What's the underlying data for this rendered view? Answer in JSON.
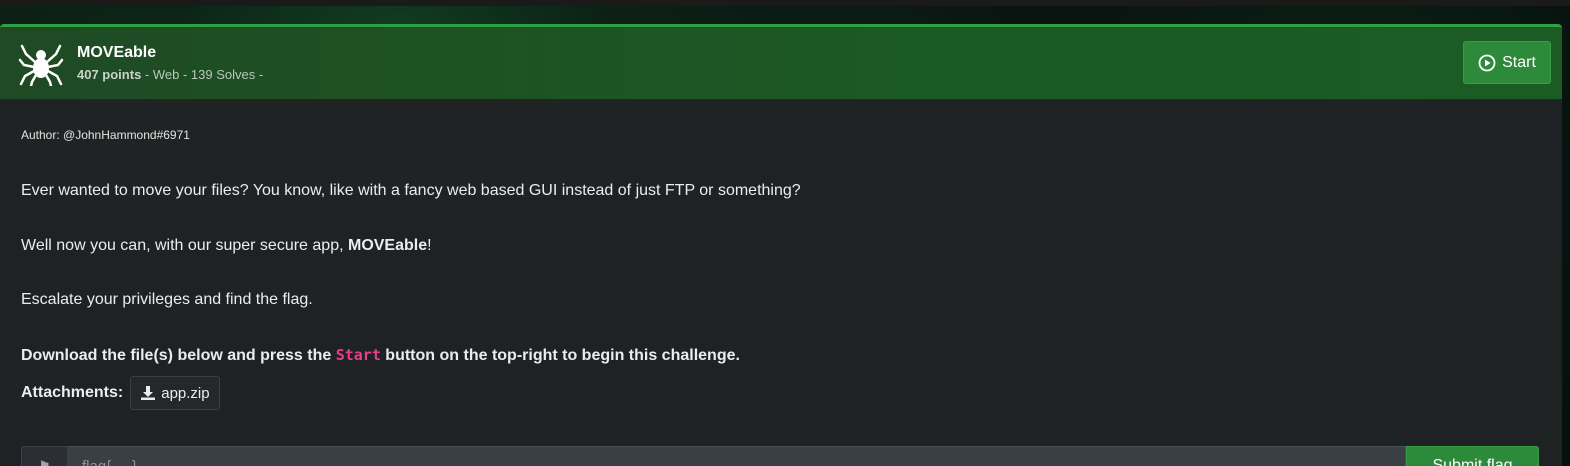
{
  "challenge": {
    "title": "MOVEable",
    "points": "407 points",
    "meta_rest": " - Web - 139 Solves -",
    "icon": "spider-icon",
    "start_label": "Start"
  },
  "body": {
    "author": "Author: @JohnHammond#6971",
    "para1": "Ever wanted to move your files? You know, like with a fancy web based GUI instead of just FTP or something?",
    "para2_pre": "Well now you can, with our super secure app, ",
    "para2_bold": "MOVEable",
    "para2_post": "!",
    "para3": "Escalate your privileges and find the flag.",
    "para4_pre": "Download the file(s) below and press the ",
    "para4_code": "Start",
    "para4_post": " button on the top-right to begin this challenge.",
    "attachments_label": "Attachments:",
    "attachment_file": "app.zip"
  },
  "flag_form": {
    "placeholder": "flag{ ... }",
    "submit_label": "Submit flag"
  },
  "colors": {
    "accent_green": "#2d8a3a",
    "header_green": "#1c5a24",
    "code_pink": "#e83e8c"
  }
}
